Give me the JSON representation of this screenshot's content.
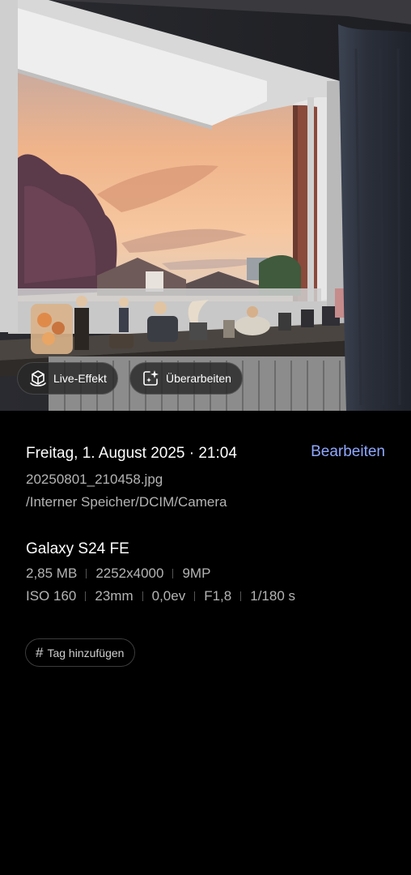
{
  "photo": {
    "live_effect_label": "Live-Effekt",
    "enhance_label": "Überarbeiten"
  },
  "details": {
    "datetime": "Freitag, 1. August 2025 · 21:04",
    "edit_label": "Bearbeiten",
    "filename": "20250801_210458.jpg",
    "path": "/Interner Speicher/DCIM/Camera",
    "device": "Galaxy S24 FE",
    "size": "2,85 MB",
    "resolution": "2252x4000",
    "megapixels": "9MP",
    "iso": "ISO 160",
    "focal_length": "23mm",
    "exposure": "0,0ev",
    "aperture": "F1,8",
    "shutter": "1/180 s"
  },
  "tags": {
    "add_tag_label": "Tag hinzufügen"
  },
  "colors": {
    "accent": "#8fa8ff",
    "background": "#000000",
    "secondary_text": "#b4b4b4"
  }
}
